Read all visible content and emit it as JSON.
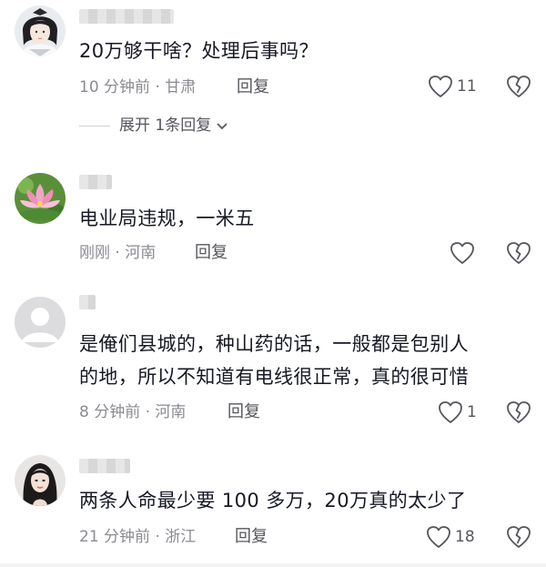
{
  "comments": [
    {
      "username": "",
      "text": "20万够干啥？处理后事吗？",
      "meta": "10 分钟前 · 甘肃",
      "reply_label": "回复",
      "likes": "11",
      "expand_label": "展开 1条回复"
    },
    {
      "username": "",
      "text": "电业局违规，一米五",
      "meta": "刚刚 · 河南",
      "reply_label": "回复",
      "likes": ""
    },
    {
      "username": "",
      "text_line1": "是俺们县城的，种山药的话，一般都是包别人",
      "text_line2": "的地，所以不知道有电线很正常，真的很可惜",
      "meta": "8 分钟前 · 河南",
      "reply_label": "回复",
      "likes": "1"
    },
    {
      "username": "",
      "text": "两条人命最少要 100 多万，20万真的太少了",
      "meta": "21 分钟前 · 浙江",
      "reply_label": "回复",
      "likes": "18"
    }
  ],
  "icons": {
    "like": "heart-outline-icon",
    "dislike": "broken-heart-icon",
    "expand": "chevron-down-icon"
  },
  "colors": {
    "text": "#161823",
    "meta": "#8a8b91",
    "icon": "#55565c"
  }
}
